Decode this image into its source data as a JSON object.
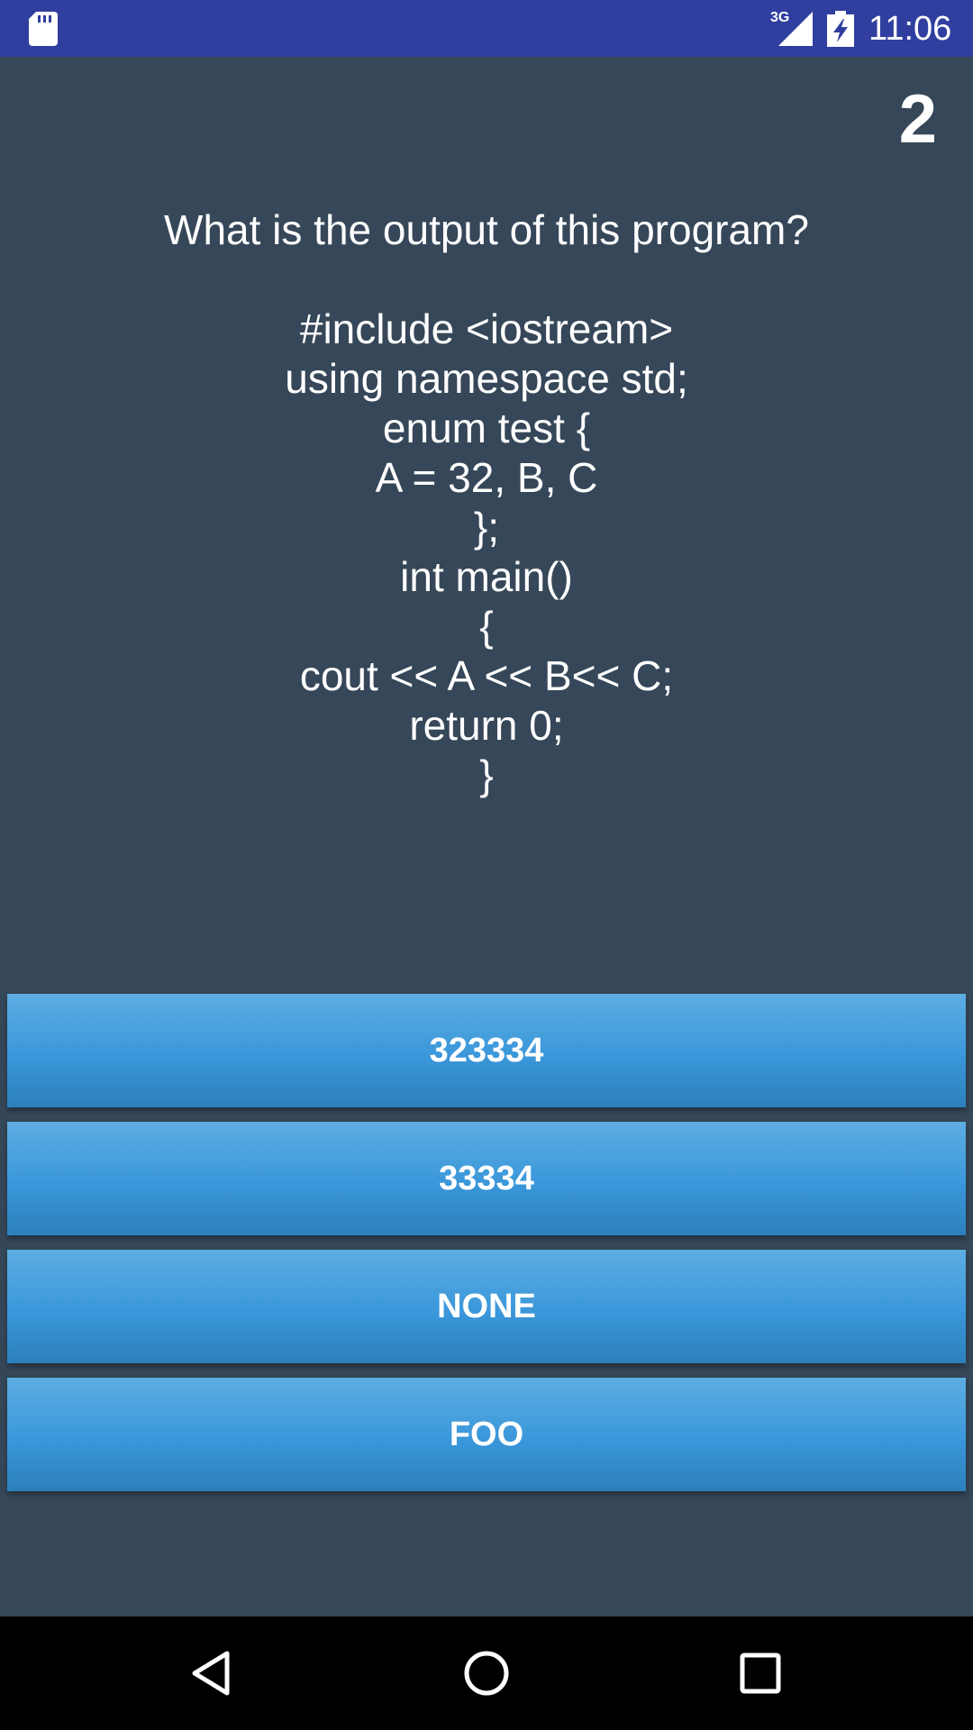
{
  "status_bar": {
    "network": "3G",
    "time": "11:06",
    "icons": [
      "sd-card-icon",
      "signal-icon",
      "battery-charging-icon"
    ]
  },
  "quiz": {
    "question_number": "2",
    "question": "What is the output of this program?\n\n#include <iostream>\nusing namespace std;\nenum test {\nA = 32, B, C\n};\nint main()\n{\ncout << A << B<< C;\nreturn 0;\n}",
    "answers": [
      "323334",
      "33334",
      "NONE",
      "FOO"
    ]
  },
  "nav_bar": {
    "icons": [
      "back-icon",
      "home-icon",
      "recents-icon"
    ]
  },
  "colors": {
    "status_bar": "#303f9f",
    "background": "#364759",
    "button_top": "#5dade2",
    "button_bottom": "#2c7fbb"
  }
}
